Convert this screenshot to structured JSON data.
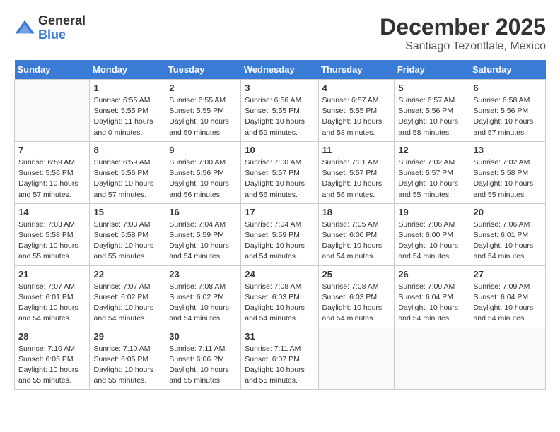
{
  "logo": {
    "general": "General",
    "blue": "Blue"
  },
  "title": "December 2025",
  "location": "Santiago Tezontlale, Mexico",
  "days_header": [
    "Sunday",
    "Monday",
    "Tuesday",
    "Wednesday",
    "Thursday",
    "Friday",
    "Saturday"
  ],
  "weeks": [
    [
      {
        "day": "",
        "info": ""
      },
      {
        "day": "1",
        "info": "Sunrise: 6:55 AM\nSunset: 5:55 PM\nDaylight: 11 hours\nand 0 minutes."
      },
      {
        "day": "2",
        "info": "Sunrise: 6:55 AM\nSunset: 5:55 PM\nDaylight: 10 hours\nand 59 minutes."
      },
      {
        "day": "3",
        "info": "Sunrise: 6:56 AM\nSunset: 5:55 PM\nDaylight: 10 hours\nand 59 minutes."
      },
      {
        "day": "4",
        "info": "Sunrise: 6:57 AM\nSunset: 5:55 PM\nDaylight: 10 hours\nand 58 minutes."
      },
      {
        "day": "5",
        "info": "Sunrise: 6:57 AM\nSunset: 5:56 PM\nDaylight: 10 hours\nand 58 minutes."
      },
      {
        "day": "6",
        "info": "Sunrise: 6:58 AM\nSunset: 5:56 PM\nDaylight: 10 hours\nand 57 minutes."
      }
    ],
    [
      {
        "day": "7",
        "info": "Sunrise: 6:59 AM\nSunset: 5:56 PM\nDaylight: 10 hours\nand 57 minutes."
      },
      {
        "day": "8",
        "info": "Sunrise: 6:59 AM\nSunset: 5:56 PM\nDaylight: 10 hours\nand 57 minutes."
      },
      {
        "day": "9",
        "info": "Sunrise: 7:00 AM\nSunset: 5:56 PM\nDaylight: 10 hours\nand 56 minutes."
      },
      {
        "day": "10",
        "info": "Sunrise: 7:00 AM\nSunset: 5:57 PM\nDaylight: 10 hours\nand 56 minutes."
      },
      {
        "day": "11",
        "info": "Sunrise: 7:01 AM\nSunset: 5:57 PM\nDaylight: 10 hours\nand 56 minutes."
      },
      {
        "day": "12",
        "info": "Sunrise: 7:02 AM\nSunset: 5:57 PM\nDaylight: 10 hours\nand 55 minutes."
      },
      {
        "day": "13",
        "info": "Sunrise: 7:02 AM\nSunset: 5:58 PM\nDaylight: 10 hours\nand 55 minutes."
      }
    ],
    [
      {
        "day": "14",
        "info": "Sunrise: 7:03 AM\nSunset: 5:58 PM\nDaylight: 10 hours\nand 55 minutes."
      },
      {
        "day": "15",
        "info": "Sunrise: 7:03 AM\nSunset: 5:58 PM\nDaylight: 10 hours\nand 55 minutes."
      },
      {
        "day": "16",
        "info": "Sunrise: 7:04 AM\nSunset: 5:59 PM\nDaylight: 10 hours\nand 54 minutes."
      },
      {
        "day": "17",
        "info": "Sunrise: 7:04 AM\nSunset: 5:59 PM\nDaylight: 10 hours\nand 54 minutes."
      },
      {
        "day": "18",
        "info": "Sunrise: 7:05 AM\nSunset: 6:00 PM\nDaylight: 10 hours\nand 54 minutes."
      },
      {
        "day": "19",
        "info": "Sunrise: 7:06 AM\nSunset: 6:00 PM\nDaylight: 10 hours\nand 54 minutes."
      },
      {
        "day": "20",
        "info": "Sunrise: 7:06 AM\nSunset: 6:01 PM\nDaylight: 10 hours\nand 54 minutes."
      }
    ],
    [
      {
        "day": "21",
        "info": "Sunrise: 7:07 AM\nSunset: 6:01 PM\nDaylight: 10 hours\nand 54 minutes."
      },
      {
        "day": "22",
        "info": "Sunrise: 7:07 AM\nSunset: 6:02 PM\nDaylight: 10 hours\nand 54 minutes."
      },
      {
        "day": "23",
        "info": "Sunrise: 7:08 AM\nSunset: 6:02 PM\nDaylight: 10 hours\nand 54 minutes."
      },
      {
        "day": "24",
        "info": "Sunrise: 7:08 AM\nSunset: 6:03 PM\nDaylight: 10 hours\nand 54 minutes."
      },
      {
        "day": "25",
        "info": "Sunrise: 7:08 AM\nSunset: 6:03 PM\nDaylight: 10 hours\nand 54 minutes."
      },
      {
        "day": "26",
        "info": "Sunrise: 7:09 AM\nSunset: 6:04 PM\nDaylight: 10 hours\nand 54 minutes."
      },
      {
        "day": "27",
        "info": "Sunrise: 7:09 AM\nSunset: 6:04 PM\nDaylight: 10 hours\nand 54 minutes."
      }
    ],
    [
      {
        "day": "28",
        "info": "Sunrise: 7:10 AM\nSunset: 6:05 PM\nDaylight: 10 hours\nand 55 minutes."
      },
      {
        "day": "29",
        "info": "Sunrise: 7:10 AM\nSunset: 6:05 PM\nDaylight: 10 hours\nand 55 minutes."
      },
      {
        "day": "30",
        "info": "Sunrise: 7:11 AM\nSunset: 6:06 PM\nDaylight: 10 hours\nand 55 minutes."
      },
      {
        "day": "31",
        "info": "Sunrise: 7:11 AM\nSunset: 6:07 PM\nDaylight: 10 hours\nand 55 minutes."
      },
      {
        "day": "",
        "info": ""
      },
      {
        "day": "",
        "info": ""
      },
      {
        "day": "",
        "info": ""
      }
    ]
  ]
}
